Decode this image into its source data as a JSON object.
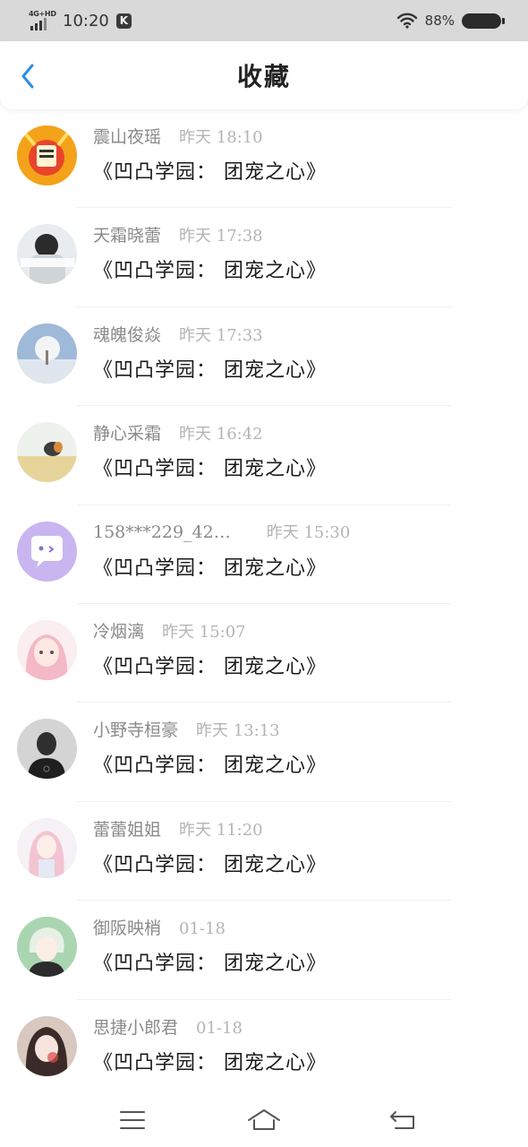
{
  "status_bar": {
    "network": "4G+HD",
    "time": "10:20",
    "app_badge": "K",
    "battery": "88%"
  },
  "header": {
    "title": "收藏"
  },
  "items": [
    {
      "username": "震山夜瑶",
      "time": "昨天 18:10",
      "content": "《凹凸学园： 团宠之心》"
    },
    {
      "username": "天霜晓蕾",
      "time": "昨天 17:38",
      "content": "《凹凸学园： 团宠之心》"
    },
    {
      "username": "魂魄俊焱",
      "time": "昨天 17:33",
      "content": "《凹凸学园： 团宠之心》"
    },
    {
      "username": "静心采霜",
      "time": "昨天 16:42",
      "content": "《凹凸学园： 团宠之心》"
    },
    {
      "username": "158***229_42…",
      "time": "昨天 15:30",
      "content": "《凹凸学园： 团宠之心》"
    },
    {
      "username": "冷烟漓",
      "time": "昨天 15:07",
      "content": "《凹凸学园： 团宠之心》"
    },
    {
      "username": "小野寺桓豪",
      "time": "昨天 13:13",
      "content": "《凹凸学园： 团宠之心》"
    },
    {
      "username": "蕾蕾姐姐",
      "time": "昨天 11:20",
      "content": "《凹凸学园： 团宠之心》"
    },
    {
      "username": "御阪映梢",
      "time": "01-18",
      "content": "《凹凸学园： 团宠之心》"
    },
    {
      "username": "思捷小郎君",
      "time": "01-18",
      "content": "《凹凸学园： 团宠之心》"
    }
  ],
  "colors": {
    "accent": "#2b8de8",
    "username": "#8a8a8a",
    "time": "#b4b4b4",
    "status_bar_bg": "#d9d9d9"
  },
  "icons": {
    "back": "chevron-left-icon",
    "nav_menu": "menu-icon",
    "nav_home": "home-icon",
    "nav_back": "return-icon"
  }
}
